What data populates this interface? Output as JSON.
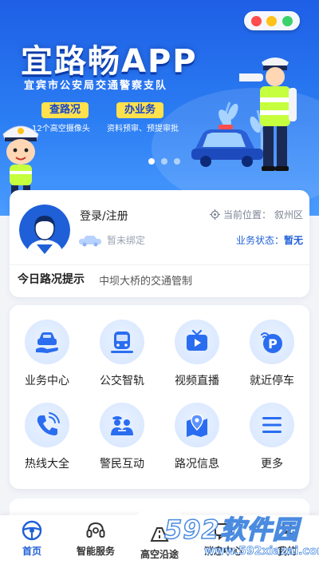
{
  "banner": {
    "title": "宜路畅APP",
    "subtitle": "宜宾市公安局交通警察支队",
    "tag1": "查路况",
    "tag1_desc": "12个高空摄像头",
    "tag2": "办业务",
    "tag2_desc": "资料预审、预提审批",
    "carousel_pages": 3,
    "carousel_active": 1,
    "traffic_light_colors": [
      "#ff4d4d",
      "#ffc21a",
      "#3ad16b"
    ],
    "icons": [
      "traffic-light-icon",
      "police-car-icon",
      "traffic-officer-illustration",
      "police-mascot-illustration"
    ]
  },
  "user": {
    "login_label": "登录/注册",
    "vehicle_status": "暂未绑定",
    "location_label": "当前位置：",
    "location_value": "叙州区",
    "business_label": "业务状态：",
    "business_value": "暂无"
  },
  "notice": {
    "label": "今日路况提示",
    "text": "中坝大桥的交通管制"
  },
  "services": [
    {
      "label": "业务中心",
      "icon": "car-hand-icon"
    },
    {
      "label": "公交智轨",
      "icon": "bus-icon"
    },
    {
      "label": "视频直播",
      "icon": "tv-play-icon"
    },
    {
      "label": "就近停车",
      "icon": "parking-icon"
    },
    {
      "label": "热线大全",
      "icon": "phone-icon"
    },
    {
      "label": "警民互动",
      "icon": "police-people-icon"
    },
    {
      "label": "路况信息",
      "icon": "map-pin-icon"
    },
    {
      "label": "更多",
      "icon": "menu-icon"
    }
  ],
  "tabbar": {
    "home": "首页",
    "smart": "智能服务",
    "center": "高空沿途",
    "msg": "消息中心",
    "mine": "我的",
    "active": "home"
  },
  "watermark": {
    "brand": "592软件园",
    "url": "www.592xiazai.com"
  },
  "colors": {
    "primary": "#1f5fd8",
    "banner_top": "#1e5fe6",
    "tag_yellow": "#ffe14d",
    "icon_bg": "#dbe8ff"
  }
}
